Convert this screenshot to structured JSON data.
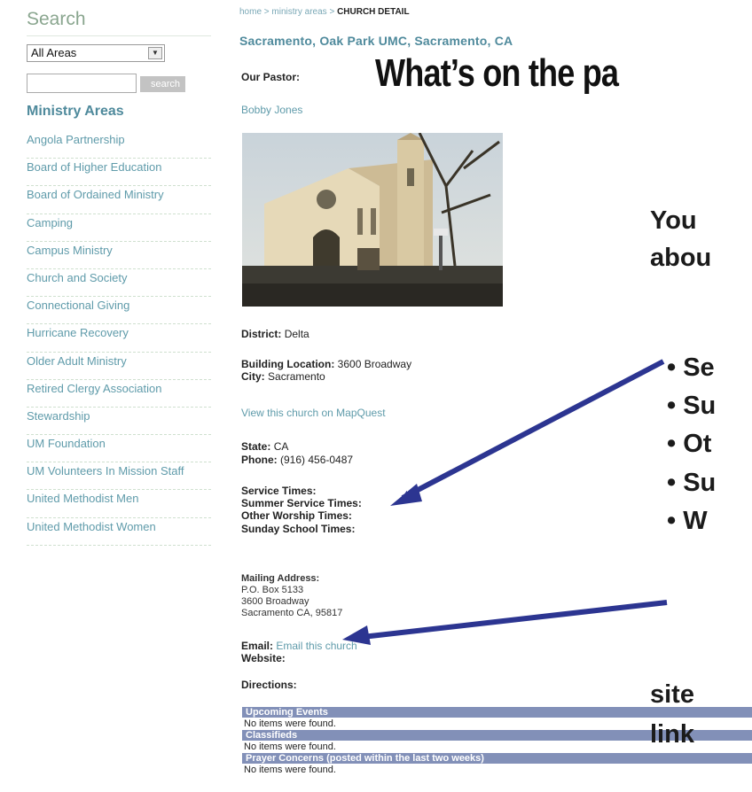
{
  "sidebar": {
    "search_title": "Search",
    "area_select_value": "All Areas",
    "search_button": "search",
    "ministry_heading": "Ministry Areas",
    "ministry_items": [
      "Angola Partnership",
      "Board of Higher Education",
      "Board of Ordained Ministry",
      "Camping",
      "Campus Ministry",
      "Church and Society",
      "Connectional Giving",
      "Hurricane Recovery",
      "Older Adult Ministry",
      "Retired Clergy Association",
      "Stewardship",
      "UM Foundation",
      "UM Volunteers In Mission Staff",
      "United Methodist Men",
      "United Methodist Women"
    ]
  },
  "breadcrumb": {
    "home": "home",
    "sep": " > ",
    "ministry_areas": "ministry areas",
    "current": "CHURCH DETAIL"
  },
  "church": {
    "title": "Sacramento, Oak Park UMC, Sacramento, CA",
    "pastor_label": "Our Pastor:",
    "pastor_name": "Bobby Jones",
    "district_label": "District:",
    "district": "Delta",
    "building_label": "Building Location:",
    "building": "3600 Broadway",
    "city_label": "City:",
    "city": "Sacramento",
    "mapquest_link": "View this church on MapQuest",
    "state_label": "State:",
    "state": "CA",
    "phone_label": "Phone:",
    "phone": "(916) 456-0487",
    "service_times": "Service Times:",
    "summer_service_times": "Summer Service Times:",
    "other_worship_times": "Other Worship Times:",
    "sunday_school_times": "Sunday School Times:",
    "mailing_label": "Mailing Address:",
    "mailing_line1": "P.O. Box 5133",
    "mailing_line2": "3600 Broadway",
    "mailing_line3": "Sacramento CA, 95817",
    "email_label": "Email:",
    "email_link": "Email this church",
    "website_label": "Website:",
    "directions_label": "Directions:"
  },
  "sections": {
    "upcoming_events": "Upcoming Events",
    "classifieds": "Classifieds",
    "prayer_concerns": "Prayer Concerns (posted within the last two weeks)",
    "empty_message": "No items were found."
  },
  "slide": {
    "title": "What’s on the pa",
    "intro_line1": "You",
    "intro_line2": "abou",
    "bullets": [
      "• Se",
      "• Su",
      "• Ot",
      "• Su",
      "• W"
    ],
    "tail_line1": "site",
    "tail_line2": "link",
    "arrow_color": "#2c3591"
  }
}
